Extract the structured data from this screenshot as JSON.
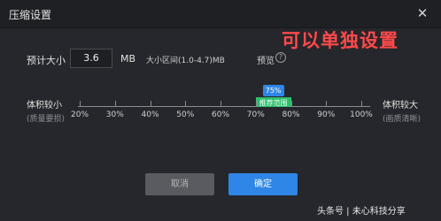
{
  "window": {
    "title": "压缩设置",
    "close_glyph": "✕"
  },
  "overlay": {
    "text": "可以单独设置",
    "color": "#ff4a4a"
  },
  "settings": {
    "estimate_label": "预计大小",
    "size_value": "3.6",
    "unit": "MB",
    "range_text": "大小区间(1.0-4.7)MB",
    "preview_label": "预览",
    "help_glyph": "?"
  },
  "slider": {
    "left_main": "体积较小",
    "left_sub": "(质量要损)",
    "right_main": "体积较大",
    "right_sub": "(画质清晰)",
    "min": 20,
    "max": 100,
    "value": 75,
    "value_label": "75%",
    "recommend_label": "推荐范围",
    "recommend_range": [
      70,
      80
    ],
    "ticks": [
      "20%",
      "30%",
      "40%",
      "50%",
      "60%",
      "70%",
      "80%",
      "90%",
      "100%"
    ],
    "tick_values": [
      20,
      30,
      40,
      50,
      60,
      70,
      80,
      90,
      100
    ]
  },
  "buttons": {
    "cancel": "取消",
    "ok": "确定"
  },
  "watermark": "头条号 | 未心科技分享",
  "colors": {
    "accent": "#2f86e6",
    "recommend": "#2dbf6c",
    "background": "#26272c"
  }
}
